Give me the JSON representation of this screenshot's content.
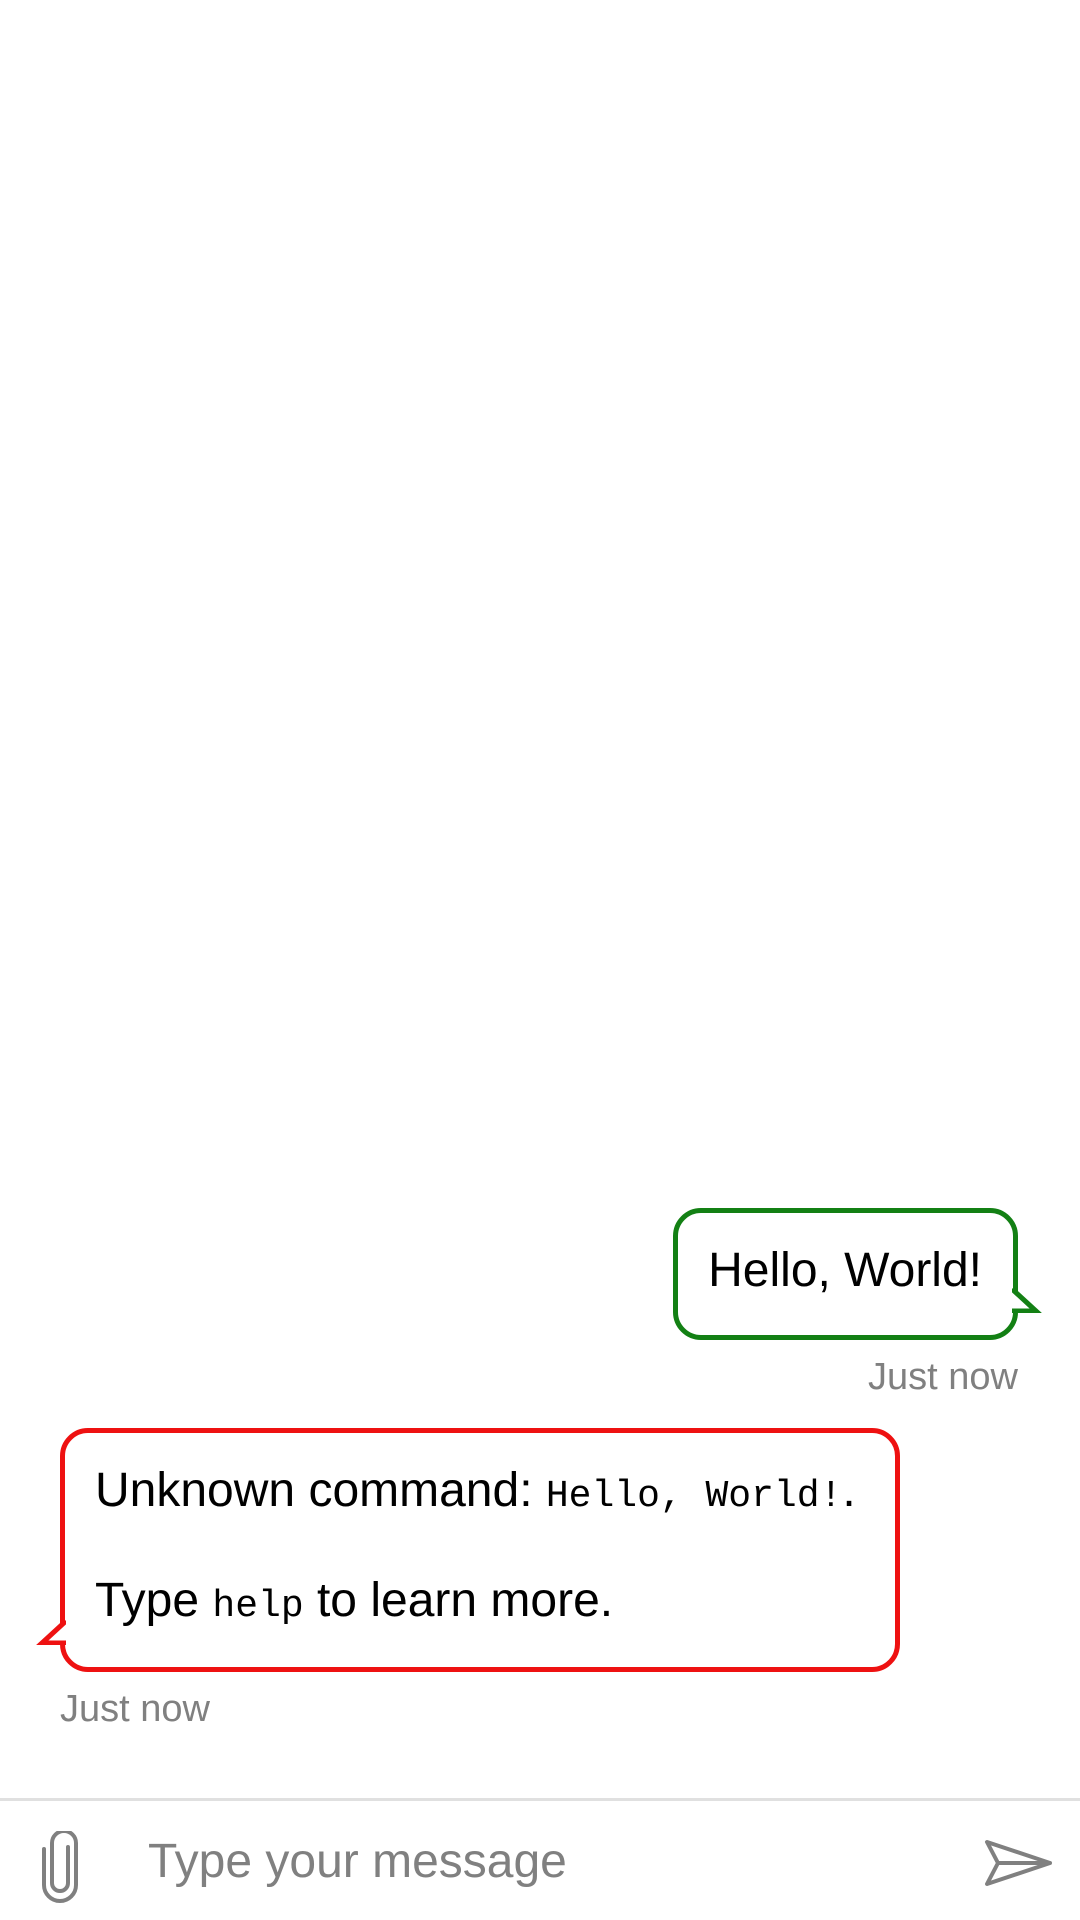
{
  "messages": [
    {
      "direction": "outgoing",
      "text": "Hello, World!",
      "time": "Just now",
      "border_color": "#138014"
    },
    {
      "direction": "incoming",
      "line1_prefix": "Unknown command: ",
      "line1_code": "Hello, World!",
      "line1_suffix": ".",
      "line2_prefix": "Type ",
      "line2_code": "help",
      "line2_suffix": " to learn more.",
      "time": "Just now",
      "border_color": "#ee1111"
    }
  ],
  "composer": {
    "placeholder": "Type your message",
    "value": "",
    "attach_icon": "paperclip-icon",
    "send_icon": "send-icon"
  }
}
